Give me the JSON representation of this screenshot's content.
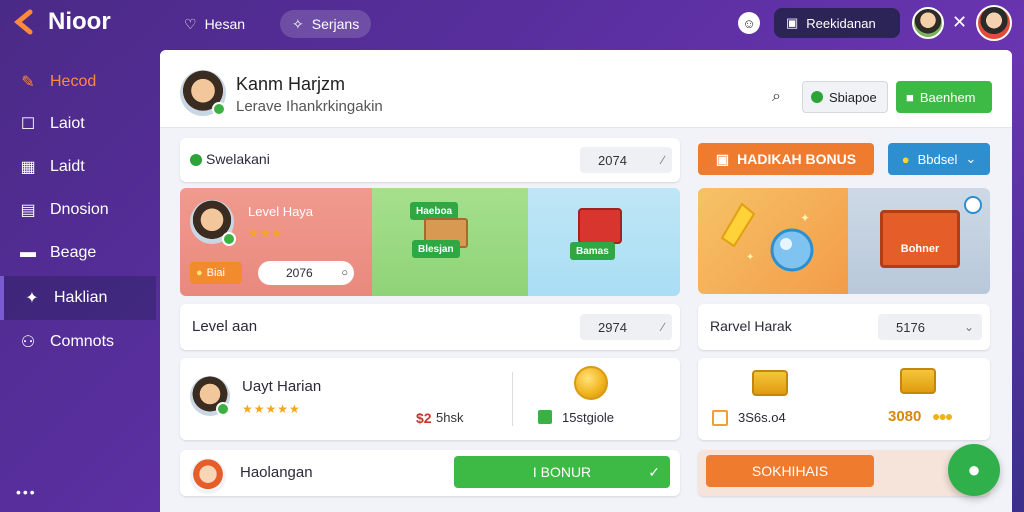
{
  "app": {
    "name": "Nioor"
  },
  "topbar": {
    "tabs": [
      {
        "label": "Hesan",
        "icon": "heart-icon"
      },
      {
        "label": "Serjans",
        "icon": "sparkle-icon"
      }
    ],
    "user_pill": {
      "label": "Reekidanan",
      "icon": "camera-icon"
    }
  },
  "sidebar": {
    "items": [
      {
        "label": "Hecod",
        "icon": "edit-icon",
        "active": true
      },
      {
        "label": "Laiot",
        "icon": "chat-icon"
      },
      {
        "label": "Laidt",
        "icon": "calendar-icon"
      },
      {
        "label": "Dnosion",
        "icon": "grid-icon"
      },
      {
        "label": "Beage",
        "icon": "folder-icon"
      },
      {
        "label": "Haklian",
        "icon": "wrench-icon",
        "selected": true
      },
      {
        "label": "Comnots",
        "icon": "people-icon"
      }
    ],
    "more": "•••"
  },
  "header": {
    "name": "Kanm Harjzm",
    "subtitle": "Lerave Ihankrkingakin",
    "btn_secondary": "Sbiapoe",
    "btn_primary": "Baenhem"
  },
  "row1": {
    "title": "Swelakani",
    "value": "2074",
    "bonus_btn": "HADIKAH BONUS",
    "side_btn": "Bbdsel"
  },
  "banner": {
    "name": "Level Haya",
    "stars": "★★★",
    "chip": "Biai",
    "value": "2076",
    "tag1": "Haeboa",
    "tag2": "Blesjan",
    "tag3": "Bamas",
    "box_label": "Bohner"
  },
  "row2": {
    "title": "Level aan",
    "value": "2974",
    "right_title": "Rarvel Harak",
    "right_value": "5176"
  },
  "row3": {
    "name": "Uayt Harian",
    "stars": "★★★★★",
    "price": "$2",
    "price_suffix": "5hsk",
    "coin_text": "15stgiole",
    "right_left": "3S6s.o4",
    "right_right": "3080"
  },
  "row4": {
    "name": "Haolangan",
    "green_btn": "I BONUR",
    "orange_btn": "SOKHIHAIS"
  },
  "colors": {
    "accent": "#ff8a3d",
    "green": "#3dba45",
    "purple": "#4a2a86"
  }
}
